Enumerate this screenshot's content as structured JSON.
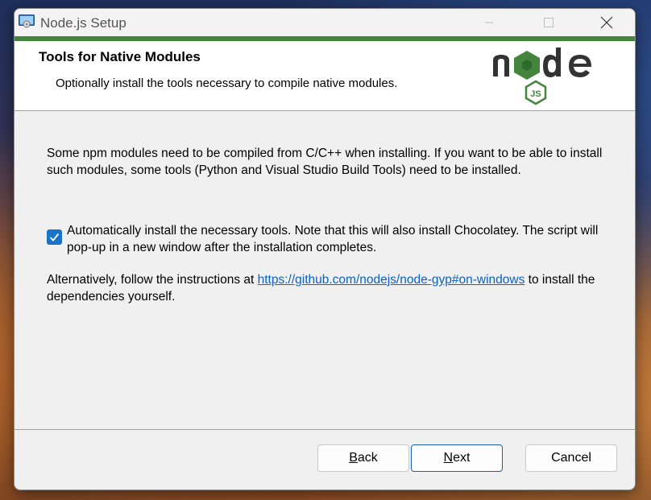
{
  "window": {
    "title": "Node.js Setup",
    "accent_color": "#43853d"
  },
  "banner": {
    "title": "Tools for Native Modules",
    "subtitle": "Optionally install the tools necessary to compile native modules.",
    "logo": "node-js-logo"
  },
  "content": {
    "description": "Some npm modules need to be compiled from C/C++ when installing. If you want to be able to install such modules, some tools (Python and Visual Studio Build Tools) need to be installed.",
    "checkbox": {
      "checked": true,
      "label": "Automatically install the necessary tools. Note that this will also install Chocolatey. The script will pop-up in a new window after the installation completes."
    },
    "alternative_prefix": "Alternatively, follow the instructions at ",
    "alternative_link": "https://github.com/nodejs/node-gyp#on-windows",
    "alternative_suffix": " to install the dependencies yourself."
  },
  "buttons": {
    "back_first": "B",
    "back_rest": "ack",
    "next_first": "N",
    "next_rest": "ext",
    "cancel": "Cancel"
  }
}
